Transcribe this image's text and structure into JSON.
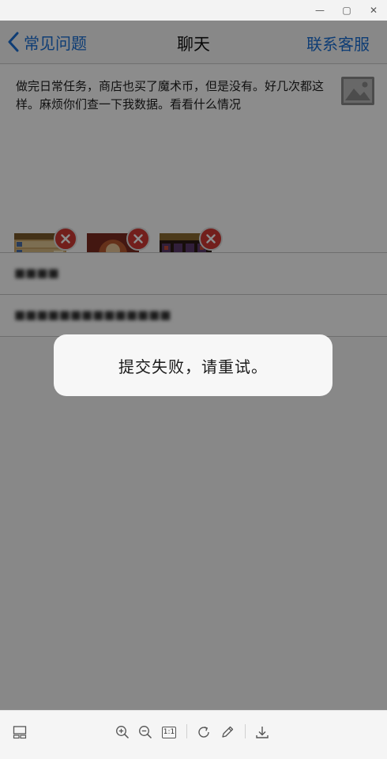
{
  "window": {
    "minimize_glyph": "—",
    "maximize_glyph": "▢",
    "close_glyph": "✕"
  },
  "nav": {
    "back_label": "常见问题",
    "title": "聊天",
    "right_label": "联系客服",
    "accent_color": "#1a6fd6"
  },
  "message": {
    "text": "做完日常任务，商店也买了魔术币，但是没有。好几次都这样。麻烦你们查一下我数据。看看什么情况",
    "attachments": [
      {
        "name": "screenshot-thumbnail-1"
      },
      {
        "name": "screenshot-thumbnail-2"
      },
      {
        "name": "screenshot-thumbnail-3"
      }
    ]
  },
  "form": {
    "field1_value": "■■■■",
    "field2_value": "■■■■■■■■■■■■■■"
  },
  "toast": {
    "text": "提交失败，请重试。"
  },
  "toolbar": {
    "icons": [
      "thumbnail-strip-icon",
      "zoom-in-icon",
      "zoom-out-icon",
      "actual-size-icon",
      "rotate-icon",
      "edit-icon",
      "download-icon"
    ],
    "actual_size_label": "1:1"
  }
}
